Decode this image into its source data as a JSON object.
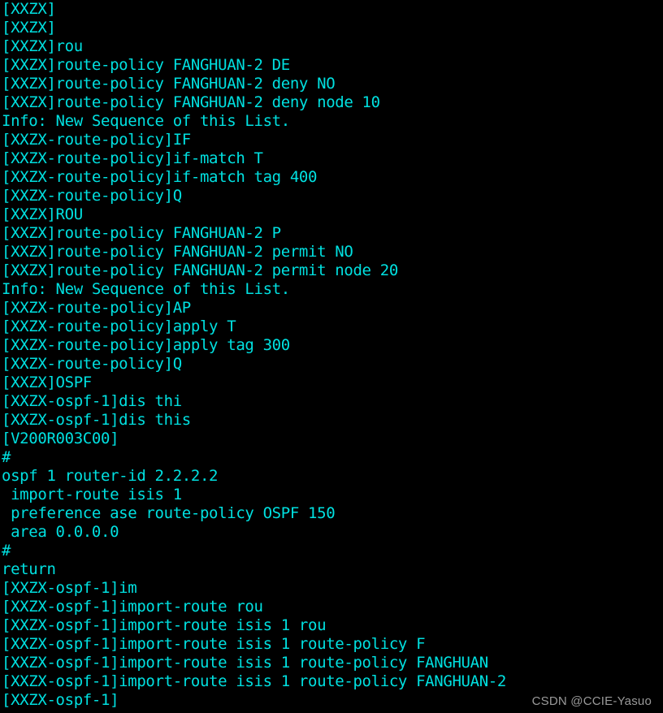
{
  "terminal": {
    "background_color": "#000000",
    "text_color": "#00e0e0",
    "watermark_color": "#9a9a9a",
    "device_prompt": "[XXZX]",
    "route_policy_prompt": "[XXZX-route-policy]",
    "ospf_prompt": "[XXZX-ospf-1]",
    "version_banner": "[V200R003C00]",
    "lines": [
      "[XXZX]",
      "[XXZX]",
      "[XXZX]rou",
      "[XXZX]route-policy FANGHUAN-2 DE",
      "[XXZX]route-policy FANGHUAN-2 deny NO",
      "[XXZX]route-policy FANGHUAN-2 deny node 10",
      "Info: New Sequence of this List.",
      "[XXZX-route-policy]IF",
      "[XXZX-route-policy]if-match T",
      "[XXZX-route-policy]if-match tag 400",
      "[XXZX-route-policy]Q",
      "[XXZX]ROU",
      "[XXZX]route-policy FANGHUAN-2 P",
      "[XXZX]route-policy FANGHUAN-2 permit NO",
      "[XXZX]route-policy FANGHUAN-2 permit node 20",
      "Info: New Sequence of this List.",
      "[XXZX-route-policy]AP",
      "[XXZX-route-policy]apply T",
      "[XXZX-route-policy]apply tag 300",
      "[XXZX-route-policy]Q",
      "[XXZX]OSPF",
      "[XXZX-ospf-1]dis thi",
      "[XXZX-ospf-1]dis this",
      "[V200R003C00]",
      "#",
      "ospf 1 router-id 2.2.2.2",
      " import-route isis 1",
      " preference ase route-policy OSPF 150",
      " area 0.0.0.0",
      "#",
      "return",
      "[XXZX-ospf-1]im",
      "[XXZX-ospf-1]import-route rou",
      "[XXZX-ospf-1]import-route isis 1 rou",
      "[XXZX-ospf-1]import-route isis 1 route-policy F",
      "[XXZX-ospf-1]import-route isis 1 route-policy FANGHUAN",
      "[XXZX-ospf-1]import-route isis 1 route-policy FANGHUAN-2",
      "[XXZX-ospf-1]"
    ]
  },
  "watermark": {
    "text": "CSDN @CCIE-Yasuo"
  }
}
